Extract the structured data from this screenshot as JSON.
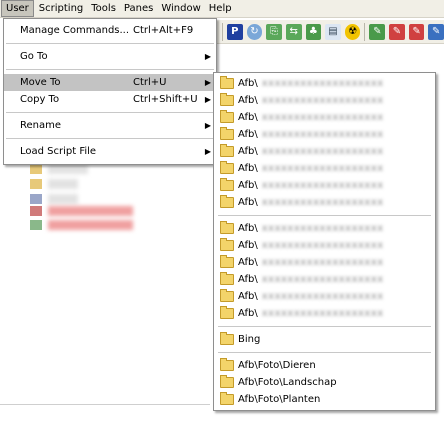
{
  "menubar": [
    "User",
    "Scripting",
    "Tools",
    "Panes",
    "Window",
    "Help"
  ],
  "user_menu": {
    "groups": [
      [
        {
          "label": "Manage Commands...",
          "shortcut": "Ctrl+Alt+F9",
          "submenu": false
        }
      ],
      [
        {
          "label": "Go To",
          "shortcut": "",
          "submenu": true
        }
      ],
      [
        {
          "label": "Move To",
          "shortcut": "Ctrl+U",
          "submenu": true,
          "selected": true
        },
        {
          "label": "Copy To",
          "shortcut": "Ctrl+Shift+U",
          "submenu": true
        }
      ],
      [
        {
          "label": "Rename",
          "shortcut": "",
          "submenu": true
        }
      ],
      [
        {
          "label": "Load Script File",
          "shortcut": "",
          "submenu": true
        }
      ]
    ]
  },
  "move_to_submenu": {
    "groups": [
      [
        "Afb\\",
        "Afb\\",
        "Afb\\",
        "Afb\\",
        "Afb\\",
        "Afb\\",
        "Afb\\",
        "Afb\\"
      ],
      [
        "Afb\\",
        "Afb\\",
        "Afb\\",
        "Afb\\",
        "Afb\\",
        "Afb\\"
      ],
      [
        "Bing"
      ],
      [
        "Afb\\Foto\\Dieren",
        "Afb\\Foto\\Landschap",
        "Afb\\Foto\\Planten"
      ]
    ],
    "blurred_suffix": "xxxxxxxxxxxxxxxxxxx"
  },
  "toolbar_icons": [
    "p-icon",
    "refresh-icon",
    "copy-icon",
    "move-icon",
    "tree-icon",
    "document-icon",
    "radiation-icon",
    "tool1-icon",
    "tool2-icon",
    "tool3-icon",
    "tool4-icon"
  ],
  "colors": {
    "menubar_bg": "#f1efe6",
    "selection": "#c3c3c3",
    "active_menu": "#c7c5bc"
  }
}
